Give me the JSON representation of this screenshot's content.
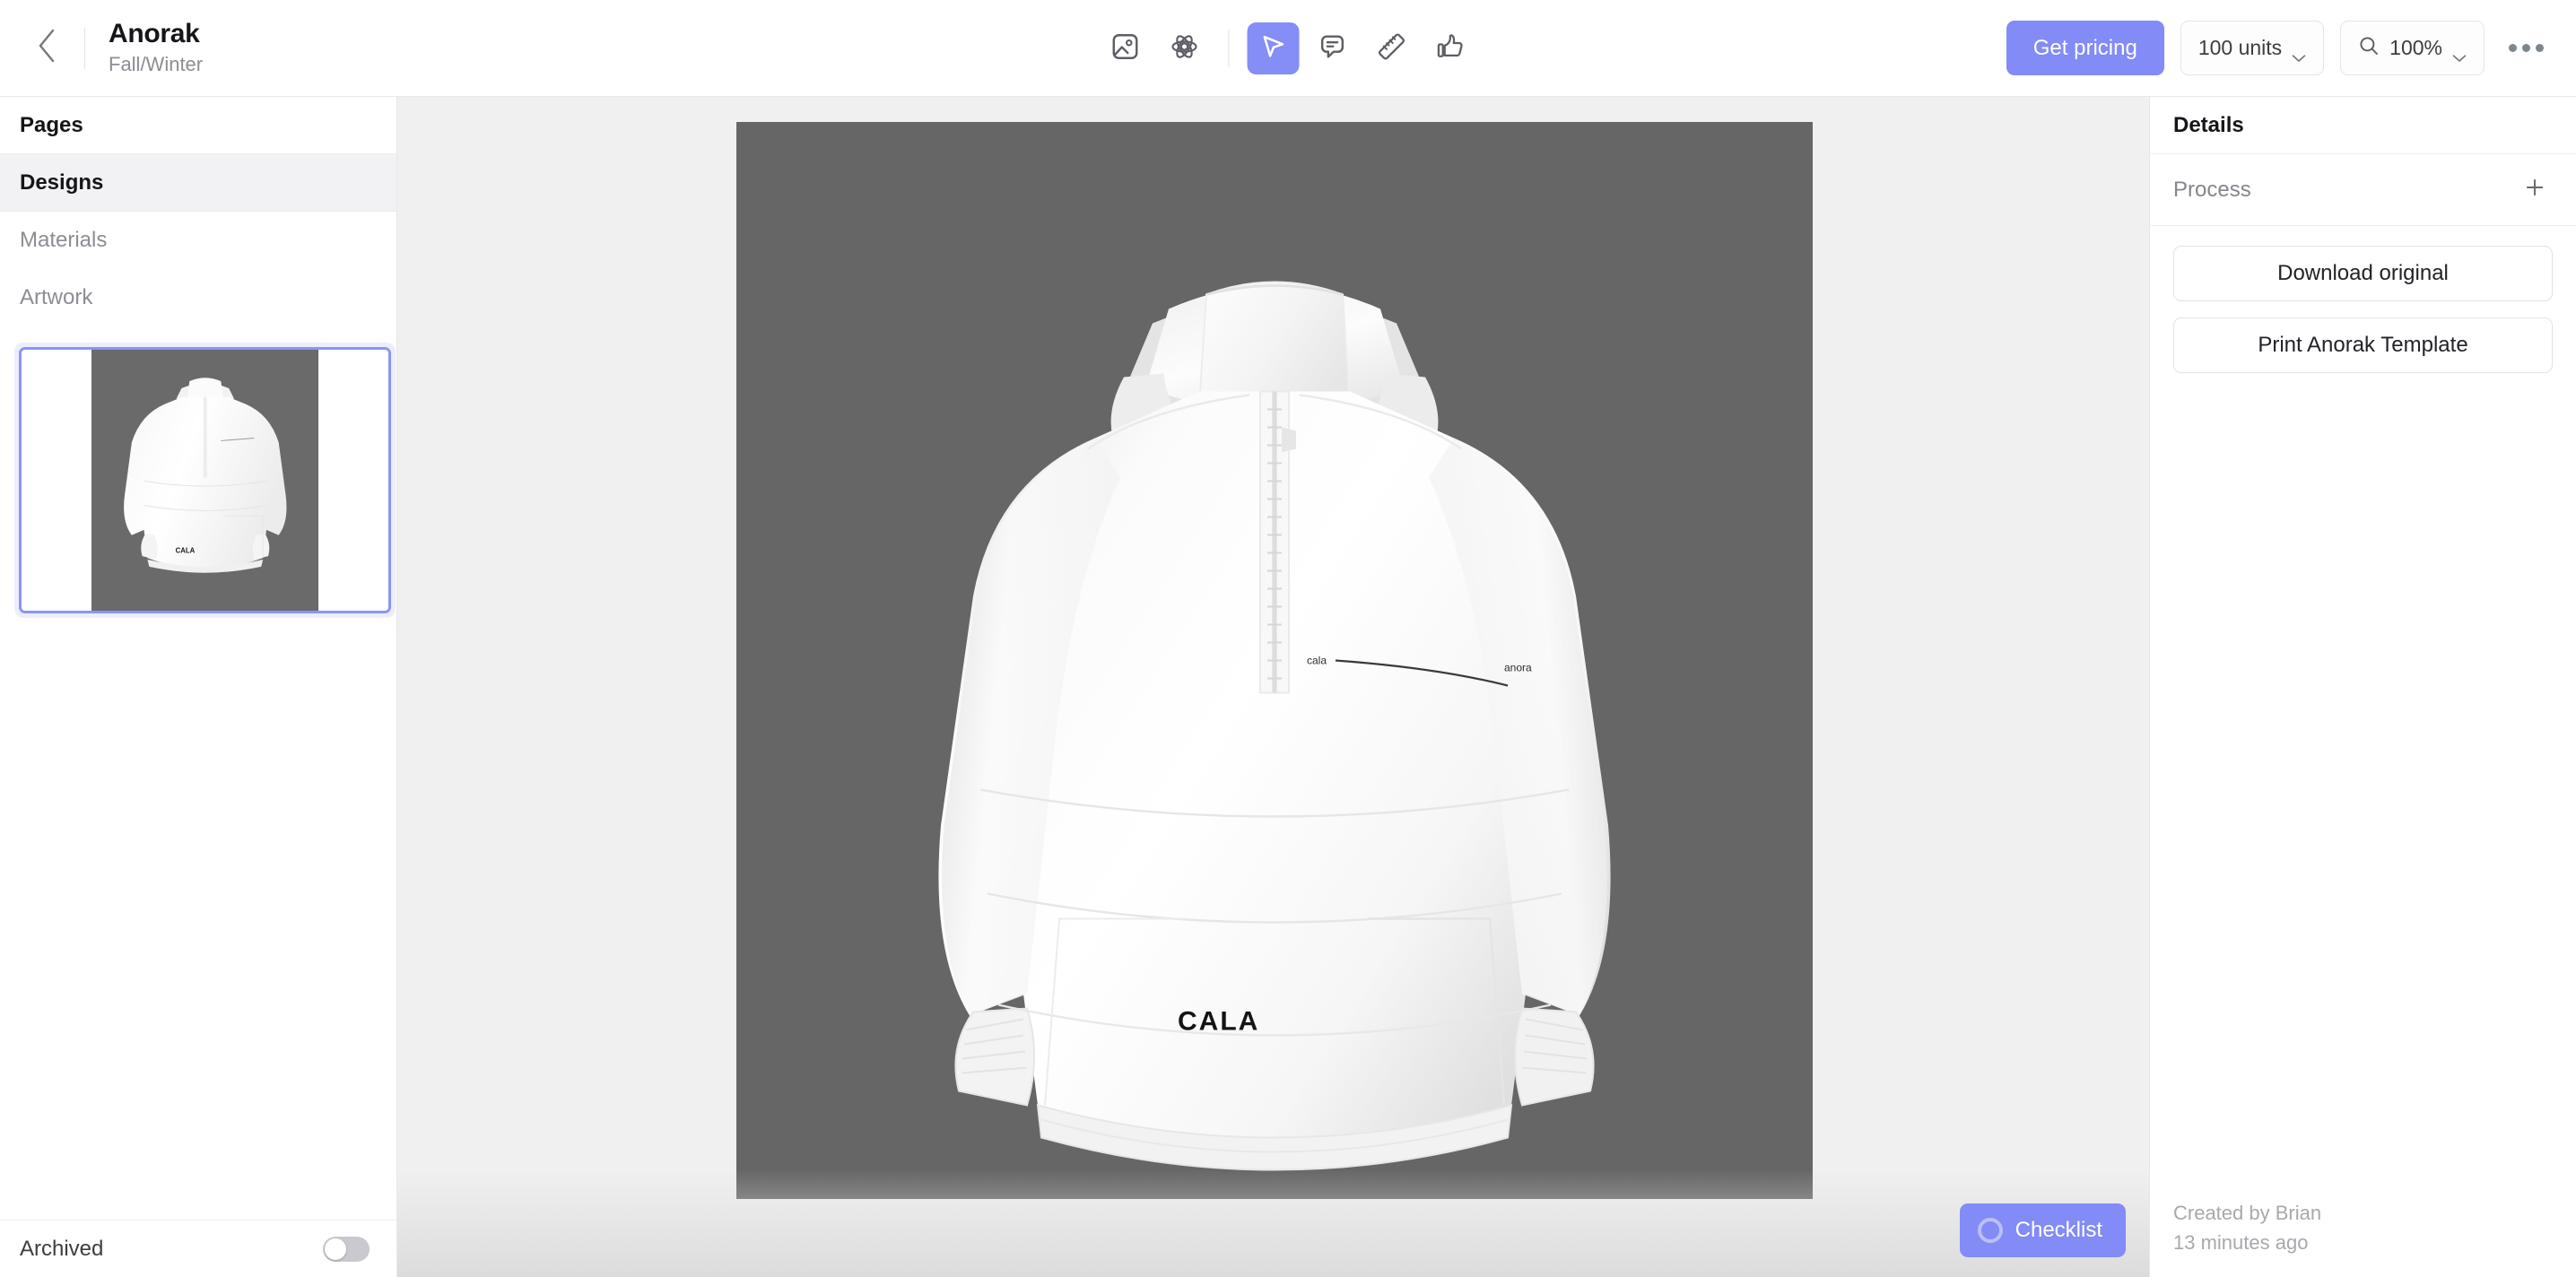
{
  "header": {
    "back_icon": "chevron-left-icon",
    "title": "Anorak",
    "subtitle": "Fall/Winter",
    "tools": [
      {
        "name": "image-tool",
        "icon": "image-icon",
        "active": false
      },
      {
        "name": "material-tool",
        "icon": "atom-icon",
        "active": false
      },
      {
        "name": "select-tool",
        "icon": "cursor-icon",
        "active": true
      },
      {
        "name": "comment-tool",
        "icon": "comment-icon",
        "active": false
      },
      {
        "name": "measure-tool",
        "icon": "ruler-icon",
        "active": false
      },
      {
        "name": "approve-tool",
        "icon": "thumbs-up-icon",
        "active": false
      }
    ],
    "get_pricing_label": "Get pricing",
    "units_value": "100 units",
    "zoom_value": "100%",
    "zoom_icon": "magnifier-icon",
    "more_icon": "ellipsis-icon"
  },
  "sidebar": {
    "section_label": "Pages",
    "items": [
      {
        "label": "Designs",
        "state": "active"
      },
      {
        "label": "Materials",
        "state": "muted"
      },
      {
        "label": "Artwork",
        "state": "muted"
      }
    ],
    "thumbnail_alt": "white anorak jacket front view",
    "archived_label": "Archived",
    "archived_on": false
  },
  "canvas": {
    "brand_mark": "CALA",
    "chest_label_left": "cala",
    "chest_label_right": "anora",
    "background_color": "#f0f0f0",
    "artboard_color": "#666666",
    "checklist_label": "Checklist",
    "checklist_icon": "progress-ring-icon"
  },
  "details": {
    "title": "Details",
    "process_label": "Process",
    "add_icon": "plus-icon",
    "buttons": [
      {
        "label": "Download original"
      },
      {
        "label": "Print Anorak Template"
      }
    ],
    "created_by": "Created by Brian",
    "created_at": "13 minutes ago"
  },
  "colors": {
    "accent": "#838bf6",
    "accent_soft": "#8b93f8",
    "text": "#15151a",
    "muted": "#8d8d94",
    "border": "#e8e8ea"
  }
}
